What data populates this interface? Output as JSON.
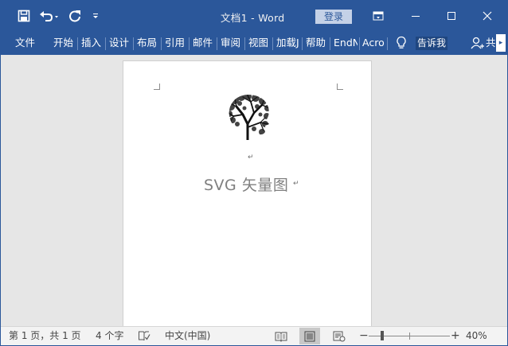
{
  "app": {
    "title": "文档1 - Word",
    "login_label": "登录"
  },
  "ribbon": {
    "tabs": [
      {
        "label": "文件"
      },
      {
        "label": "开始"
      },
      {
        "label": "插入"
      },
      {
        "label": "设计"
      },
      {
        "label": "布局"
      },
      {
        "label": "引用"
      },
      {
        "label": "邮件"
      },
      {
        "label": "审阅"
      },
      {
        "label": "视图"
      },
      {
        "label": "加载J"
      },
      {
        "label": "帮助"
      },
      {
        "label": "EndN"
      },
      {
        "label": "Acro"
      }
    ],
    "tell_me_label": "告诉我",
    "share_label": "共"
  },
  "document": {
    "text": "SVG 矢量图",
    "image_icon": "tree-silhouette-head-image"
  },
  "status": {
    "page_info": "第 1 页，共 1 页",
    "word_count": "4 个字",
    "language": "中文(中国)",
    "zoom_label": "40%",
    "zoom_percent": 40
  },
  "colors": {
    "accent": "#2b579a",
    "login_bg": "#c4d1e7",
    "page_bg": "#ffffff",
    "workspace_bg": "#e6e6e6"
  }
}
